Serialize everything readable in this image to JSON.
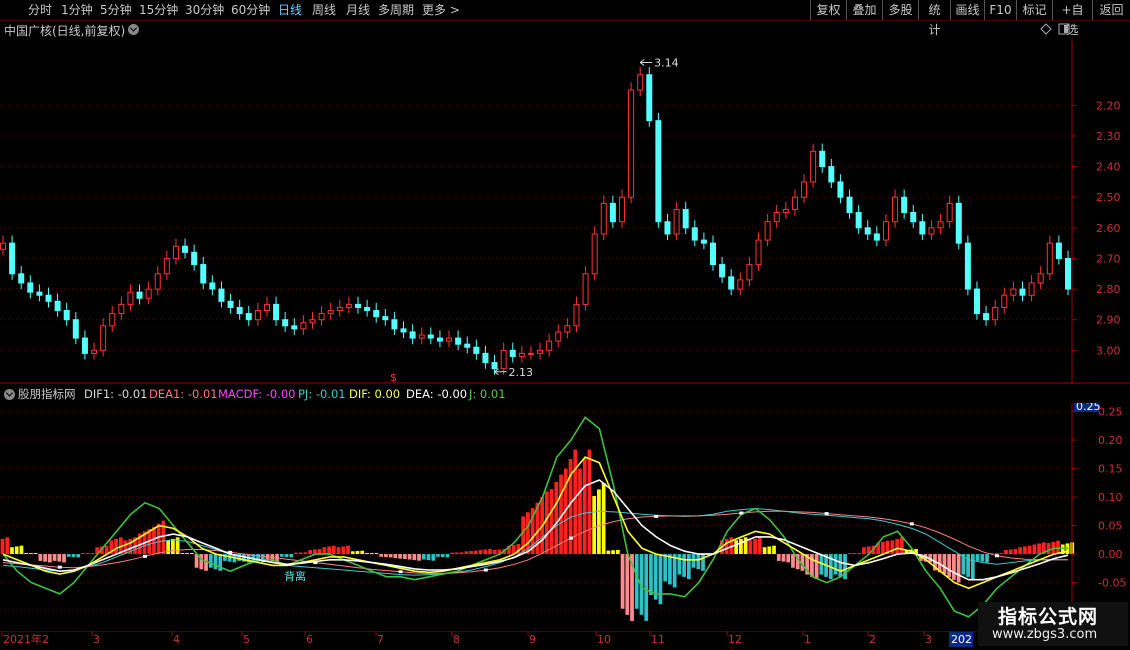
{
  "toolbar": {
    "periods": [
      "分时",
      "1分钟",
      "5分钟",
      "15分钟",
      "30分钟",
      "60分钟",
      "日线",
      "周线",
      "月线",
      "多周期",
      "更多 >"
    ],
    "active_period": "日线",
    "right_buttons": [
      "复权",
      "叠加",
      "多股",
      "统计",
      "画线",
      "F10",
      "标记",
      "+自选",
      "返回"
    ]
  },
  "main_panel": {
    "title": "中国广核(日线,前复权)",
    "high_label": "3.14",
    "low_label": "2.13",
    "marker": "$",
    "price_ticks": [
      "3.00",
      "2.90",
      "2.80",
      "2.70",
      "2.60",
      "2.50",
      "2.40",
      "2.30",
      "2.20"
    ]
  },
  "indicator_panel": {
    "name": "股朋指标网",
    "legend": [
      {
        "label": "DIF1: -0.01",
        "color": "#d8d8d8"
      },
      {
        "label": "DEA1: -0.01",
        "color": "#ff7777"
      },
      {
        "label": "MACDF: -0.00",
        "color": "#ff44ff"
      },
      {
        "label": "PJ: -0.01",
        "color": "#3fc8c8"
      },
      {
        "label": "DIF: 0.00",
        "color": "#ffff55"
      },
      {
        "label": "DEA: -0.00",
        "color": "#ffffff"
      },
      {
        "label": "J: 0.01",
        "color": "#55cc55"
      }
    ],
    "current_value": "0.25",
    "value_ticks": [
      "0.25",
      "0.20",
      "0.15",
      "0.10",
      "0.05",
      "0.00",
      "-0.05",
      "-0.10"
    ],
    "annotation": "背离"
  },
  "date_axis": {
    "labels": [
      "2021年2",
      "3",
      "4",
      "5",
      "6",
      "7",
      "8",
      "9",
      "10",
      "11",
      "12",
      "1",
      "2",
      "3",
      "202"
    ]
  },
  "watermark": {
    "title": "指标公式网",
    "url": "www.zbgs3.com"
  },
  "chart_data": [
    {
      "type": "candlestick",
      "title": "中国广核(日线,前复权)",
      "y_ticks": [
        2.2,
        2.3,
        2.4,
        2.5,
        2.6,
        2.7,
        2.8,
        2.9,
        3.0
      ],
      "ylim": [
        2.09,
        3.22
      ],
      "annotations": [
        {
          "text": "3.14",
          "value": 3.14
        },
        {
          "text": "2.13",
          "value": 2.13
        }
      ],
      "close_series": [
        2.55,
        2.45,
        2.42,
        2.39,
        2.38,
        2.36,
        2.33,
        2.3,
        2.24,
        2.19,
        2.2,
        2.28,
        2.32,
        2.35,
        2.39,
        2.37,
        2.4,
        2.45,
        2.5,
        2.54,
        2.52,
        2.48,
        2.42,
        2.4,
        2.36,
        2.34,
        2.32,
        2.3,
        2.33,
        2.35,
        2.3,
        2.28,
        2.27,
        2.29,
        2.3,
        2.32,
        2.33,
        2.34,
        2.35,
        2.34,
        2.33,
        2.31,
        2.3,
        2.27,
        2.26,
        2.24,
        2.25,
        2.24,
        2.23,
        2.24,
        2.22,
        2.21,
        2.19,
        2.16,
        2.14,
        2.2,
        2.18,
        2.19,
        2.19,
        2.2,
        2.23,
        2.26,
        2.28,
        2.35,
        2.45,
        2.58,
        2.68,
        2.62,
        2.7,
        3.05,
        3.1,
        2.95,
        2.62,
        2.58,
        2.66,
        2.6,
        2.56,
        2.55,
        2.48,
        2.44,
        2.4,
        2.43,
        2.48,
        2.56,
        2.62,
        2.65,
        2.66,
        2.7,
        2.75,
        2.85,
        2.8,
        2.75,
        2.7,
        2.65,
        2.6,
        2.58,
        2.56,
        2.62,
        2.7,
        2.65,
        2.62,
        2.58,
        2.6,
        2.62,
        2.68,
        2.55,
        2.4,
        2.32,
        2.3,
        2.34,
        2.38,
        2.4,
        2.38,
        2.42,
        2.45,
        2.55,
        2.5,
        2.4
      ]
    },
    {
      "type": "line",
      "title": "股朋指标网",
      "y_ticks": [
        0.25,
        0.2,
        0.15,
        0.1,
        0.05,
        0.0,
        -0.05,
        -0.1
      ],
      "ylim": [
        -0.135,
        0.265
      ],
      "series": [
        {
          "name": "DIF",
          "values": [
            0.0,
            -0.01,
            -0.02,
            -0.03,
            -0.035,
            -0.03,
            -0.02,
            -0.005,
            0.01,
            0.02,
            0.035,
            0.05,
            0.045,
            0.03,
            0.01,
            0.0,
            -0.005,
            -0.01,
            -0.015,
            -0.02,
            -0.02,
            -0.015,
            -0.01,
            -0.005,
            -0.005,
            -0.01,
            -0.015,
            -0.02,
            -0.025,
            -0.03,
            -0.032,
            -0.03,
            -0.025,
            -0.02,
            -0.015,
            -0.01,
            0.0,
            0.02,
            0.05,
            0.09,
            0.14,
            0.17,
            0.16,
            0.1,
            0.04,
            0.01,
            0.0,
            -0.005,
            -0.01,
            -0.01,
            0.0,
            0.02,
            0.03,
            0.04,
            0.035,
            0.02,
            0.005,
            -0.01,
            -0.02,
            -0.03,
            -0.02,
            -0.01,
            0.0,
            0.01,
            0.005,
            -0.01,
            -0.03,
            -0.05,
            -0.06,
            -0.05,
            -0.04,
            -0.03,
            -0.02,
            -0.01,
            0.0,
            0.005
          ]
        },
        {
          "name": "DEA",
          "values": [
            -0.01,
            -0.015,
            -0.02,
            -0.025,
            -0.03,
            -0.028,
            -0.02,
            -0.01,
            0.0,
            0.01,
            0.02,
            0.03,
            0.035,
            0.03,
            0.02,
            0.01,
            0.0,
            -0.005,
            -0.01,
            -0.015,
            -0.018,
            -0.016,
            -0.013,
            -0.01,
            -0.01,
            -0.012,
            -0.015,
            -0.018,
            -0.022,
            -0.026,
            -0.028,
            -0.028,
            -0.026,
            -0.022,
            -0.018,
            -0.013,
            -0.006,
            0.005,
            0.025,
            0.055,
            0.09,
            0.12,
            0.13,
            0.11,
            0.08,
            0.05,
            0.03,
            0.015,
            0.005,
            0.0,
            0.0,
            0.01,
            0.02,
            0.03,
            0.03,
            0.025,
            0.015,
            0.005,
            -0.005,
            -0.015,
            -0.02,
            -0.015,
            -0.008,
            0.0,
            0.002,
            -0.005,
            -0.018,
            -0.033,
            -0.045,
            -0.045,
            -0.04,
            -0.033,
            -0.025,
            -0.017,
            -0.008,
            -0.002
          ]
        },
        {
          "name": "J",
          "values": [
            0.0,
            -0.03,
            -0.05,
            -0.06,
            -0.07,
            -0.05,
            -0.02,
            0.01,
            0.04,
            0.07,
            0.09,
            0.08,
            0.05,
            0.02,
            -0.01,
            -0.02,
            -0.03,
            -0.02,
            -0.01,
            -0.01,
            -0.02,
            -0.01,
            0.0,
            0.0,
            -0.01,
            -0.02,
            -0.03,
            -0.04,
            -0.04,
            -0.045,
            -0.04,
            -0.035,
            -0.03,
            -0.02,
            -0.01,
            0.0,
            0.02,
            0.05,
            0.1,
            0.17,
            0.2,
            0.24,
            0.22,
            0.12,
            0.0,
            -0.06,
            -0.07,
            -0.07,
            -0.075,
            -0.05,
            -0.01,
            0.04,
            0.07,
            0.08,
            0.06,
            0.03,
            -0.01,
            -0.04,
            -0.05,
            -0.04,
            -0.02,
            0.0,
            0.03,
            0.04,
            0.01,
            -0.03,
            -0.06,
            -0.1,
            -0.11,
            -0.09,
            -0.06,
            -0.04,
            -0.02,
            0.0,
            0.01,
            0.01
          ]
        },
        {
          "name": "DIF1",
          "values": [
            -0.02,
            -0.022,
            -0.025,
            -0.028,
            -0.03,
            -0.028,
            -0.022,
            -0.015,
            -0.005,
            0.005,
            0.015,
            0.022,
            0.025,
            0.022,
            0.015,
            0.008,
            0.0,
            -0.005,
            -0.01,
            -0.015,
            -0.02,
            -0.022,
            -0.024,
            -0.026,
            -0.028,
            -0.03,
            -0.032,
            -0.034,
            -0.036,
            -0.037,
            -0.036,
            -0.035,
            -0.032,
            -0.028,
            -0.022,
            -0.015,
            -0.005,
            0.01,
            0.03,
            0.05,
            0.065,
            0.072,
            0.075,
            0.074,
            0.072,
            0.07,
            0.068,
            0.067,
            0.066,
            0.067,
            0.07,
            0.075,
            0.078,
            0.08,
            0.078,
            0.075,
            0.072,
            0.07,
            0.068,
            0.066,
            0.064,
            0.062,
            0.058,
            0.052,
            0.045,
            0.035,
            0.02,
            0.005,
            -0.01,
            -0.015,
            -0.018,
            -0.015,
            -0.012,
            -0.01,
            -0.01,
            -0.01
          ]
        },
        {
          "name": "DEA1",
          "values": [
            -0.015,
            -0.017,
            -0.019,
            -0.021,
            -0.023,
            -0.024,
            -0.022,
            -0.019,
            -0.015,
            -0.01,
            -0.004,
            0.002,
            0.006,
            0.008,
            0.008,
            0.006,
            0.003,
            0.0,
            -0.003,
            -0.006,
            -0.009,
            -0.012,
            -0.015,
            -0.018,
            -0.021,
            -0.024,
            -0.027,
            -0.029,
            -0.031,
            -0.033,
            -0.034,
            -0.034,
            -0.033,
            -0.031,
            -0.028,
            -0.024,
            -0.018,
            -0.01,
            0.002,
            0.015,
            0.028,
            0.04,
            0.05,
            0.057,
            0.062,
            0.065,
            0.066,
            0.067,
            0.067,
            0.067,
            0.068,
            0.07,
            0.072,
            0.074,
            0.075,
            0.075,
            0.074,
            0.073,
            0.071,
            0.069,
            0.067,
            0.065,
            0.062,
            0.058,
            0.053,
            0.046,
            0.037,
            0.026,
            0.014,
            0.004,
            -0.003,
            -0.007,
            -0.009,
            -0.01,
            -0.01,
            -0.01
          ]
        }
      ]
    }
  ]
}
